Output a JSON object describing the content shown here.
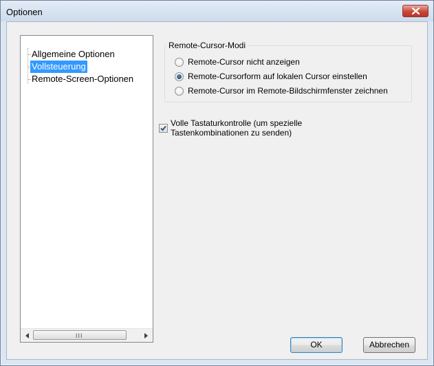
{
  "window": {
    "title": "Optionen"
  },
  "tree": {
    "items": [
      {
        "label": "Allgemeine Optionen",
        "selected": false
      },
      {
        "label": "Vollsteuerung",
        "selected": true
      },
      {
        "label": "Remote-Screen-Optionen",
        "selected": false
      }
    ],
    "scroll_grip": "III"
  },
  "cursor_group": {
    "label": "Remote-Cursor-Modi",
    "options": [
      {
        "label": "Remote-Cursor nicht anzeigen",
        "checked": false
      },
      {
        "label": "Remote-Cursorform auf lokalen Cursor einstellen",
        "checked": true
      },
      {
        "label": "Remote-Cursor im Remote-Bildschirmfenster zeichnen",
        "checked": false
      }
    ]
  },
  "keyboard_control": {
    "label": "Volle Tastaturkontrolle (um spezielle Tastenkombinationen zu senden)",
    "checked": true
  },
  "buttons": {
    "ok": "OK",
    "cancel": "Abbrechen"
  },
  "colors": {
    "selection": "#3399ff",
    "close_button": "#c9473b",
    "dialog_bg": "#f0f0f0"
  },
  "icons": [
    "close-icon",
    "scroll-left-arrow-icon",
    "scroll-right-arrow-icon",
    "checkmark-icon"
  ]
}
